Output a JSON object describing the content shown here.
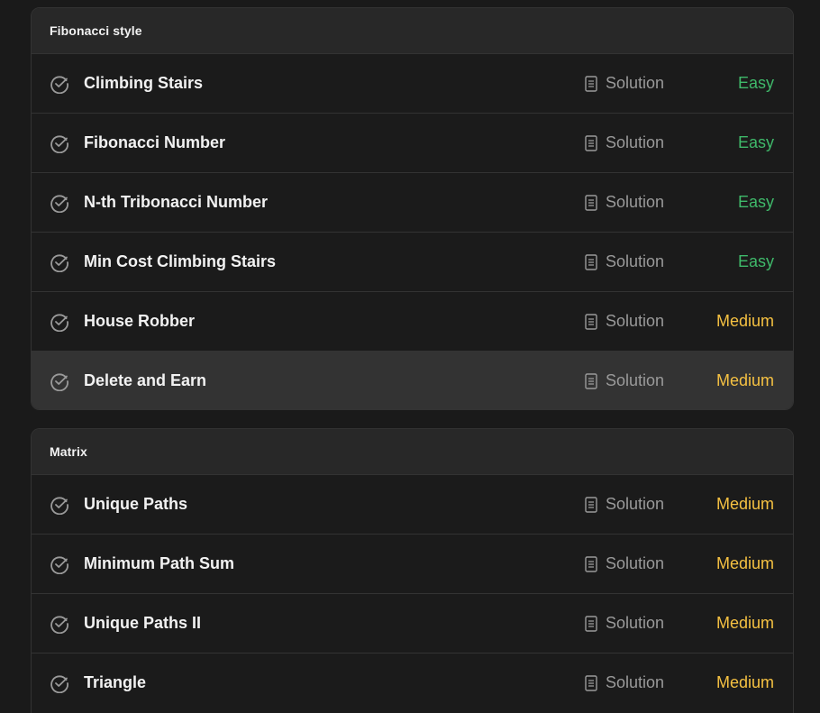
{
  "colors": {
    "easy": "#3fb96a",
    "medium": "#f5c142",
    "solution_text": "#9a9a9a",
    "background": "#1a1a1a"
  },
  "icons": {
    "status": "check-circle-icon",
    "solution": "document-icon"
  },
  "sections": [
    {
      "title": "Fibonacci style",
      "problems": [
        {
          "title": "Climbing Stairs",
          "solution_label": "Solution",
          "difficulty": "Easy"
        },
        {
          "title": "Fibonacci Number",
          "solution_label": "Solution",
          "difficulty": "Easy"
        },
        {
          "title": "N-th Tribonacci Number",
          "solution_label": "Solution",
          "difficulty": "Easy"
        },
        {
          "title": "Min Cost Climbing Stairs",
          "solution_label": "Solution",
          "difficulty": "Easy"
        },
        {
          "title": "House Robber",
          "solution_label": "Solution",
          "difficulty": "Medium"
        },
        {
          "title": "Delete and Earn",
          "solution_label": "Solution",
          "difficulty": "Medium"
        }
      ]
    },
    {
      "title": "Matrix",
      "problems": [
        {
          "title": "Unique Paths",
          "solution_label": "Solution",
          "difficulty": "Medium"
        },
        {
          "title": "Minimum Path Sum",
          "solution_label": "Solution",
          "difficulty": "Medium"
        },
        {
          "title": "Unique Paths II",
          "solution_label": "Solution",
          "difficulty": "Medium"
        },
        {
          "title": "Triangle",
          "solution_label": "Solution",
          "difficulty": "Medium"
        }
      ]
    }
  ]
}
